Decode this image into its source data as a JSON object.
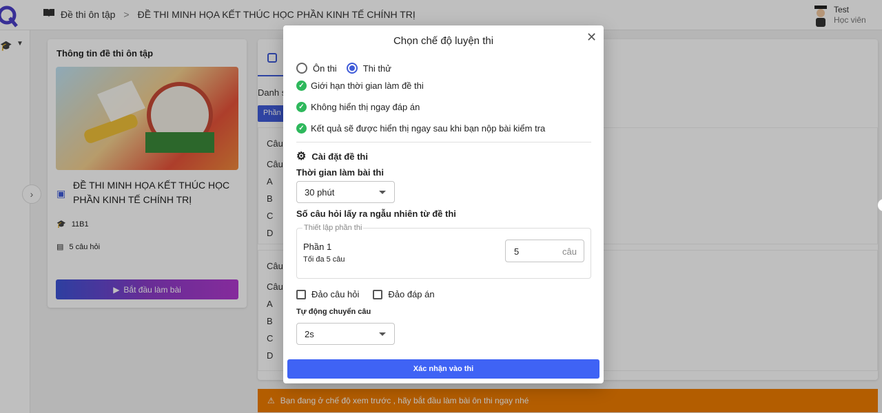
{
  "header": {
    "breadcrumb_root": "Đề thi ôn tập",
    "breadcrumb_separator": ">",
    "breadcrumb_current": "ĐỀ THI MINH HỌA KẾT THÚC HỌC PHẦN KINH TẾ CHÍNH TRỊ",
    "user_name": "Test",
    "user_role": "Học viên"
  },
  "info_card": {
    "title": "Thông tin đề thi ôn tập",
    "exam_name": "ĐỀ THI MINH HỌA KẾT THÚC HỌC PHẦN KINH TẾ CHÍNH TRỊ",
    "class_code": "11B1",
    "question_count": "5 câu hỏi",
    "start_button": "Bắt đầu làm bài"
  },
  "main": {
    "list_label": "Danh s",
    "part_chip": "Phần",
    "q_prefix": "Câu",
    "options": [
      "A",
      "B",
      "C",
      "D"
    ]
  },
  "warning": {
    "text": "Bạn đang ở chế độ xem trước , hãy bắt đầu làm bài ôn thi ngay nhé"
  },
  "modal": {
    "title": "Chọn chế độ luyện thi",
    "mode_options": [
      {
        "label": "Ôn thi",
        "selected": false
      },
      {
        "label": "Thi thử",
        "selected": true
      }
    ],
    "features": [
      "Giới hạn thời gian làm đề thi",
      "Không hiển thị ngay đáp án",
      "Kết quả sẽ được hiển thị ngay sau khi bạn nộp bài kiểm tra"
    ],
    "settings_heading": "Cài đặt đề thi",
    "time_label": "Thời gian làm bài thi",
    "time_value": "30 phút",
    "random_label": "Số câu hỏi lấy ra ngẫu nhiên từ đề thi",
    "part_setup_legend": "Thiết lập phần thi",
    "part_name": "Phần 1",
    "part_max": "Tối đa 5 câu",
    "part_count": "5",
    "part_unit": "câu",
    "shuffle_questions": "Đảo câu hỏi",
    "shuffle_answers": "Đảo đáp án",
    "auto_next_label": "Tự động chuyển câu",
    "auto_next_value": "2s",
    "confirm_button": "Xác nhận vào thi"
  },
  "colors": {
    "accent": "#3f63f5",
    "success": "#2eb85c",
    "warning": "#ef7d00"
  }
}
